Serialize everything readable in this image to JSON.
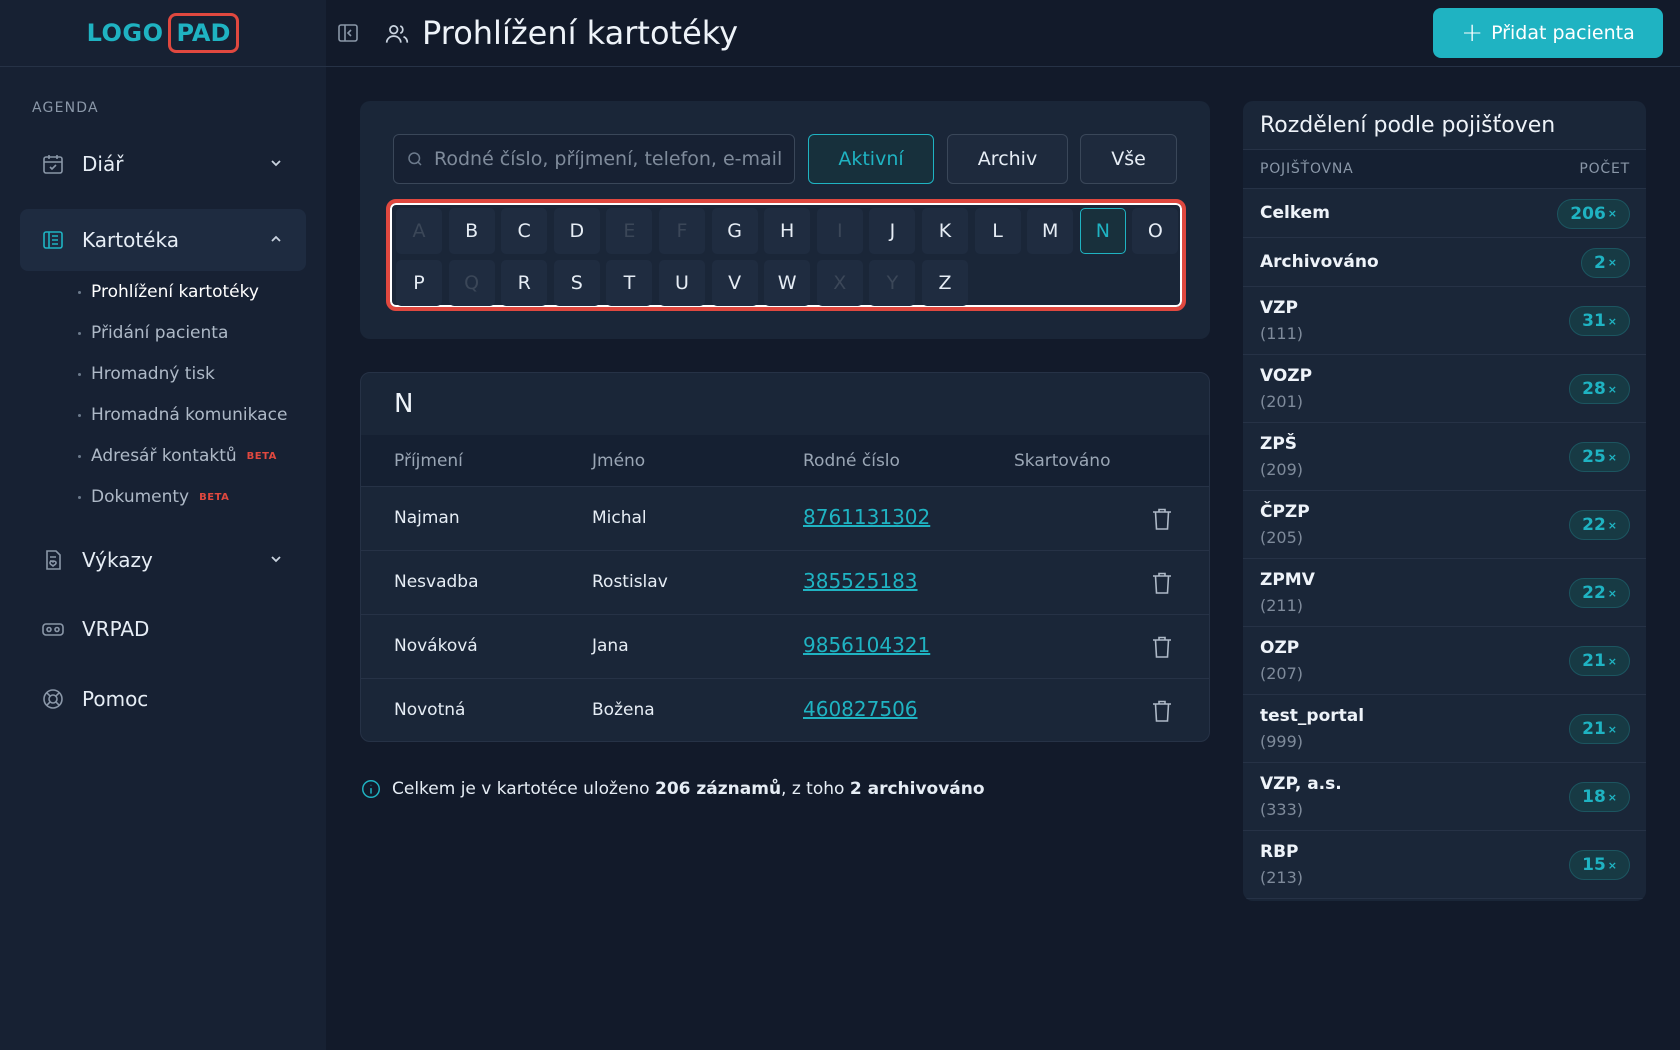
{
  "logo": {
    "left": "LOGO",
    "right": "PAD"
  },
  "sidebar": {
    "section_label": "AGENDA",
    "items": [
      {
        "label": "Diář",
        "icon": "calendar-icon",
        "expanded": false
      },
      {
        "label": "Kartotéka",
        "icon": "card-index-icon",
        "expanded": true,
        "active": true
      },
      {
        "label": "Výkazy",
        "icon": "report-icon",
        "expanded": false
      },
      {
        "label": "VRPAD",
        "icon": "vr-headset-icon"
      },
      {
        "label": "Pomoc",
        "icon": "lifebuoy-icon"
      }
    ],
    "subitems": [
      {
        "label": "Prohlížení kartotéky",
        "active": true
      },
      {
        "label": "Přidání pacienta"
      },
      {
        "label": "Hromadný tisk"
      },
      {
        "label": "Hromadná komunikace"
      },
      {
        "label": "Adresář kontaktů",
        "badge": "BETA"
      },
      {
        "label": "Dokumenty",
        "badge": "BETA"
      }
    ]
  },
  "header": {
    "title": "Prohlížení kartotéky",
    "add_button": "Přidat pacienta"
  },
  "filters": {
    "search_placeholder": "Rodné číslo, příjmení, telefon, e-mail",
    "search_value": "",
    "buttons": [
      "Aktivní",
      "Archiv",
      "Vše"
    ],
    "active_button": "Aktivní",
    "letters_row1": [
      "A",
      "B",
      "C",
      "D",
      "E",
      "F",
      "G",
      "H",
      "I",
      "J",
      "K",
      "L",
      "M",
      "N",
      "O"
    ],
    "letters_row2": [
      "P",
      "Q",
      "R",
      "S",
      "T",
      "U",
      "V",
      "W",
      "X",
      "Y",
      "Z"
    ],
    "disabled_letters": [
      "A",
      "E",
      "F",
      "I",
      "Q",
      "X",
      "Y"
    ],
    "active_letter": "N"
  },
  "table": {
    "group_letter": "N",
    "columns": [
      "Příjmení",
      "Jméno",
      "Rodné číslo",
      "Skartováno"
    ],
    "rows": [
      {
        "surname": "Najman",
        "name": "Michal",
        "birth_number": "8761131302",
        "shredded": ""
      },
      {
        "surname": "Nesvadba",
        "name": "Rostislav",
        "birth_number": "385525183",
        "shredded": ""
      },
      {
        "surname": "Nováková",
        "name": "Jana",
        "birth_number": "9856104321",
        "shredded": ""
      },
      {
        "surname": "Novotná",
        "name": "Božena",
        "birth_number": "460827506",
        "shredded": ""
      }
    ]
  },
  "summary": {
    "prefix": "Celkem je v kartotéce uloženo ",
    "total": "206 záznamů",
    "middle": ", z toho ",
    "archived": "2 archivováno"
  },
  "insurance": {
    "title": "Rozdělení podle pojišťoven",
    "col_name": "POJIŠŤOVNA",
    "col_count": "POČET",
    "rows": [
      {
        "name": "Celkem",
        "code": "",
        "count": "206"
      },
      {
        "name": "Archivováno",
        "code": "",
        "count": "2"
      },
      {
        "name": "VZP",
        "code": "(111)",
        "count": "31"
      },
      {
        "name": "VOZP",
        "code": "(201)",
        "count": "28"
      },
      {
        "name": "ZPŠ",
        "code": "(209)",
        "count": "25"
      },
      {
        "name": "ČPZP",
        "code": "(205)",
        "count": "22"
      },
      {
        "name": "ZPMV",
        "code": "(211)",
        "count": "22"
      },
      {
        "name": "OZP",
        "code": "(207)",
        "count": "21"
      },
      {
        "name": "test_portal",
        "code": "(999)",
        "count": "21"
      },
      {
        "name": "VZP, a.s.",
        "code": "(333)",
        "count": "18"
      },
      {
        "name": "RBP",
        "code": "(213)",
        "count": "15"
      }
    ],
    "count_suffix": "×"
  },
  "colors": {
    "accent": "#1fb3c2",
    "highlight": "#e0483f",
    "background": "#121a2a"
  }
}
